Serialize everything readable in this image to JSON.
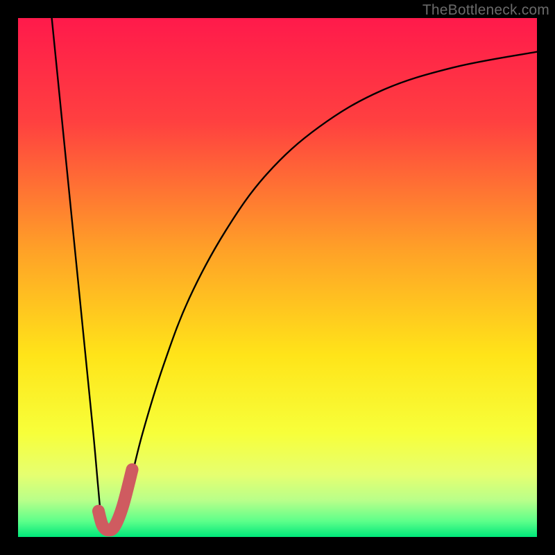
{
  "watermark": "TheBottleneck.com",
  "chart_data": {
    "type": "line",
    "title": "",
    "xlabel": "",
    "ylabel": "",
    "x_range": [
      0,
      100
    ],
    "y_range": [
      0,
      100
    ],
    "gradient_stops": [
      {
        "pos": 0.0,
        "color": "#ff1a4b"
      },
      {
        "pos": 0.2,
        "color": "#ff4040"
      },
      {
        "pos": 0.45,
        "color": "#ffa227"
      },
      {
        "pos": 0.65,
        "color": "#ffe419"
      },
      {
        "pos": 0.8,
        "color": "#f7ff3a"
      },
      {
        "pos": 0.88,
        "color": "#e6ff70"
      },
      {
        "pos": 0.93,
        "color": "#b8ff8a"
      },
      {
        "pos": 0.97,
        "color": "#5cff8a"
      },
      {
        "pos": 1.0,
        "color": "#00e77a"
      }
    ],
    "series": [
      {
        "name": "bottleneck-curve",
        "style": "thin-black",
        "points": [
          {
            "x": 6.5,
            "y": 100.0
          },
          {
            "x": 8.5,
            "y": 80.0
          },
          {
            "x": 10.5,
            "y": 60.0
          },
          {
            "x": 12.5,
            "y": 40.0
          },
          {
            "x": 14.5,
            "y": 20.0
          },
          {
            "x": 15.4,
            "y": 10.0
          },
          {
            "x": 16.0,
            "y": 4.0
          },
          {
            "x": 16.7,
            "y": 1.5
          },
          {
            "x": 17.5,
            "y": 1.0
          },
          {
            "x": 18.5,
            "y": 1.5
          },
          {
            "x": 19.8,
            "y": 4.0
          },
          {
            "x": 21.5,
            "y": 10.0
          },
          {
            "x": 24.0,
            "y": 20.0
          },
          {
            "x": 28.0,
            "y": 33.0
          },
          {
            "x": 33.0,
            "y": 46.0
          },
          {
            "x": 40.0,
            "y": 59.0
          },
          {
            "x": 48.0,
            "y": 70.0
          },
          {
            "x": 58.0,
            "y": 79.0
          },
          {
            "x": 70.0,
            "y": 86.0
          },
          {
            "x": 84.0,
            "y": 90.5
          },
          {
            "x": 100.0,
            "y": 93.5
          }
        ]
      },
      {
        "name": "highlight-j",
        "style": "thick-red",
        "points": [
          {
            "x": 15.5,
            "y": 5.0
          },
          {
            "x": 16.3,
            "y": 2.2
          },
          {
            "x": 17.5,
            "y": 1.3
          },
          {
            "x": 18.7,
            "y": 2.2
          },
          {
            "x": 20.2,
            "y": 6.0
          },
          {
            "x": 22.0,
            "y": 13.0
          }
        ]
      }
    ]
  }
}
